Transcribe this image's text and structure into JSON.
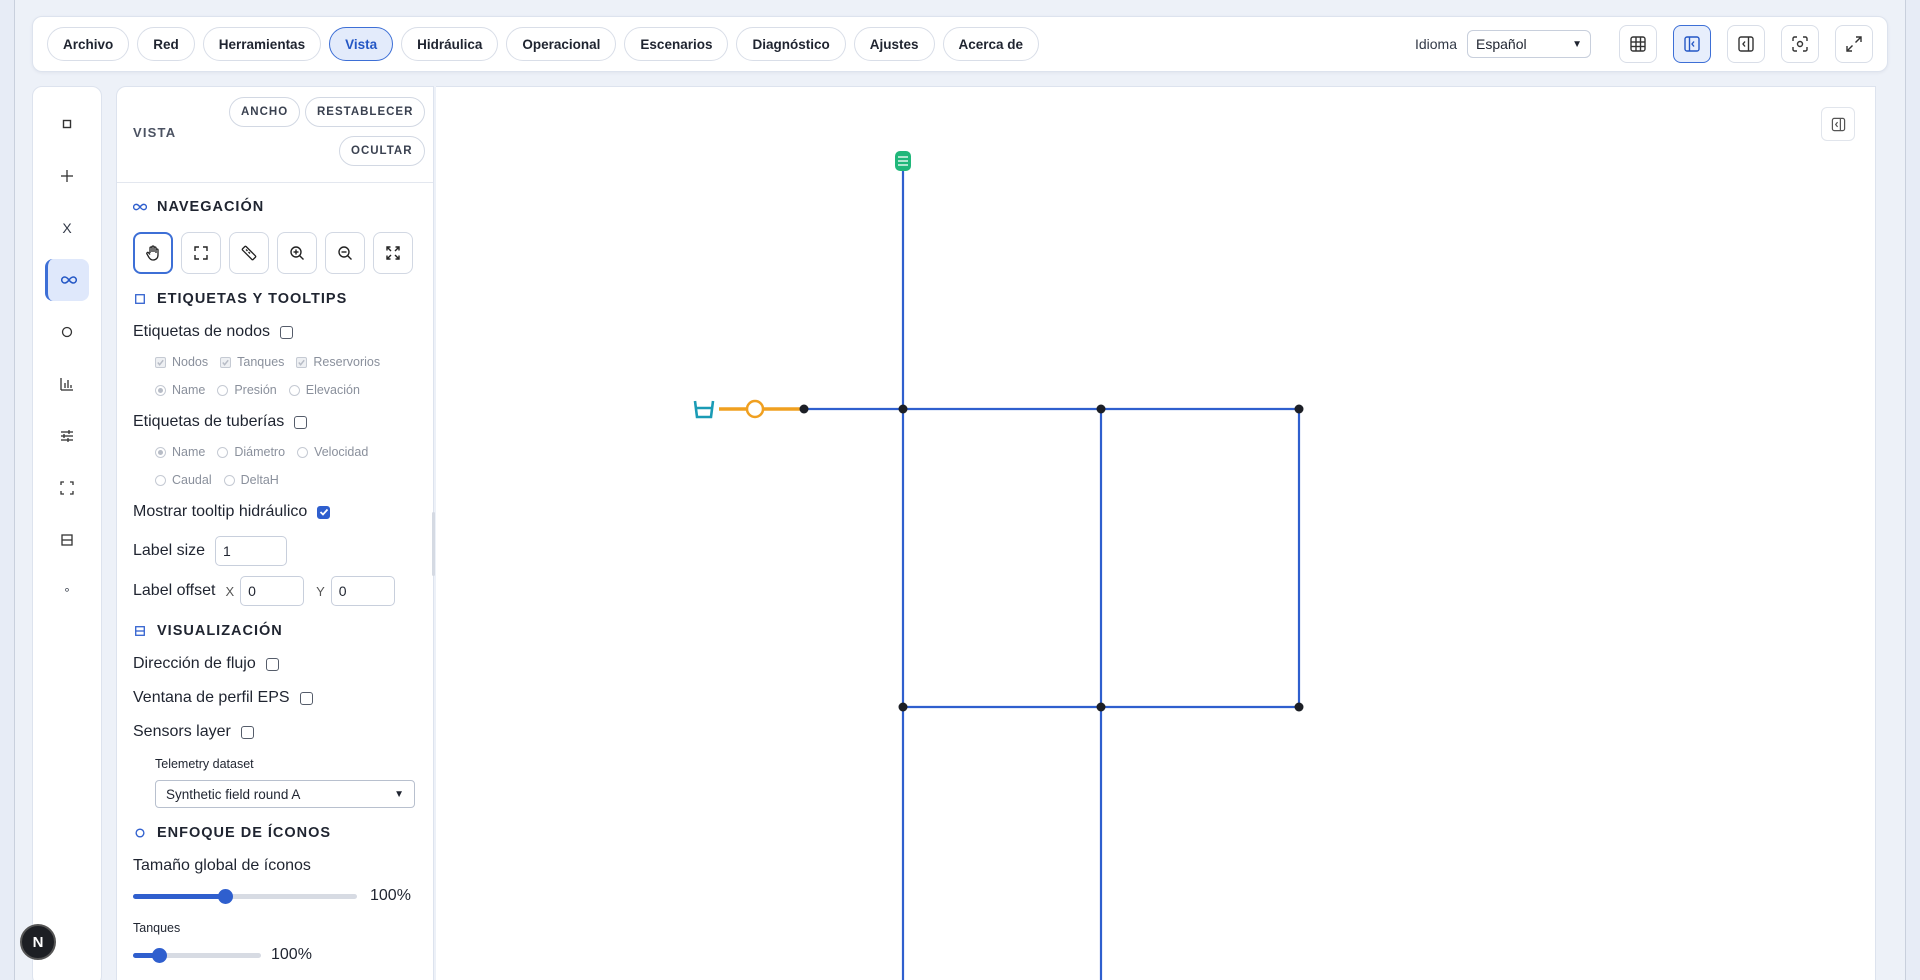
{
  "menu": {
    "items": [
      "Archivo",
      "Red",
      "Herramientas",
      "Vista",
      "Hidráulica",
      "Operacional",
      "Escenarios",
      "Diagnóstico",
      "Ajustes",
      "Acerca de"
    ],
    "active": "Vista"
  },
  "language": {
    "label": "Idioma",
    "value": "Español"
  },
  "top_icons": [
    "table-view-icon",
    "left-panel-icon",
    "right-panel-icon",
    "screenshot-icon",
    "fullscreen-icon"
  ],
  "rail": {
    "items": [
      {
        "name": "select",
        "glyph": "▫"
      },
      {
        "name": "add",
        "glyph": "+"
      },
      {
        "name": "delete",
        "glyph": "X"
      },
      {
        "name": "view",
        "glyph": "∞"
      },
      {
        "name": "node",
        "glyph": "○"
      },
      {
        "name": "chart",
        "glyph": "chart"
      },
      {
        "name": "adjust",
        "glyph": "sliders"
      },
      {
        "name": "fit",
        "glyph": "fit"
      },
      {
        "name": "layers",
        "glyph": "layers"
      },
      {
        "name": "dot",
        "glyph": "°"
      }
    ],
    "active": "view"
  },
  "panel": {
    "title": "VISTA",
    "buttons": {
      "width": "ANCHO",
      "reset": "RESTABLECER",
      "hide": "OCULTAR"
    },
    "navigation": {
      "title": "NAVEGACIÓN"
    },
    "labels": {
      "title": "ETIQUETAS Y TOOLTIPS",
      "node_labels": "Etiquetas de nodos",
      "node_types": [
        "Nodos",
        "Tanques",
        "Reservorios"
      ],
      "node_fields": [
        "Name",
        "Presión",
        "Elevación"
      ],
      "pipe_labels": "Etiquetas de tuberías",
      "pipe_fields_1": [
        "Name",
        "Diámetro",
        "Velocidad"
      ],
      "pipe_fields_2": [
        "Caudal",
        "DeltaH"
      ],
      "hydraulic_tooltip": "Mostrar tooltip hidráulico",
      "label_size": "Label size",
      "label_size_value": "1",
      "label_offset": "Label offset",
      "x_label": "X",
      "x_value": "0",
      "y_label": "Y",
      "y_value": "0"
    },
    "visualization": {
      "title": "VISUALIZACIÓN",
      "flow_direction": "Dirección de flujo",
      "eps_profile": "Ventana de perfil EPS",
      "sensors_layer": "Sensors layer",
      "telemetry_label": "Telemetry dataset",
      "telemetry_value": "Synthetic field round A"
    },
    "icon_focus": {
      "title": "ENFOQUE DE ÍCONOS",
      "global_size": "Tamaño global de íconos",
      "global_pct": "100%",
      "global_level": 0.41,
      "tanks": "Tanques",
      "tanks_pct": "100%",
      "tanks_level": 0.2
    }
  },
  "network": {
    "pipe_color": "#2f5fce",
    "pump_color": "#f0a020",
    "reservoir_color": "#1a9bb5",
    "tank_color": "#20b77a"
  },
  "badge": "N"
}
